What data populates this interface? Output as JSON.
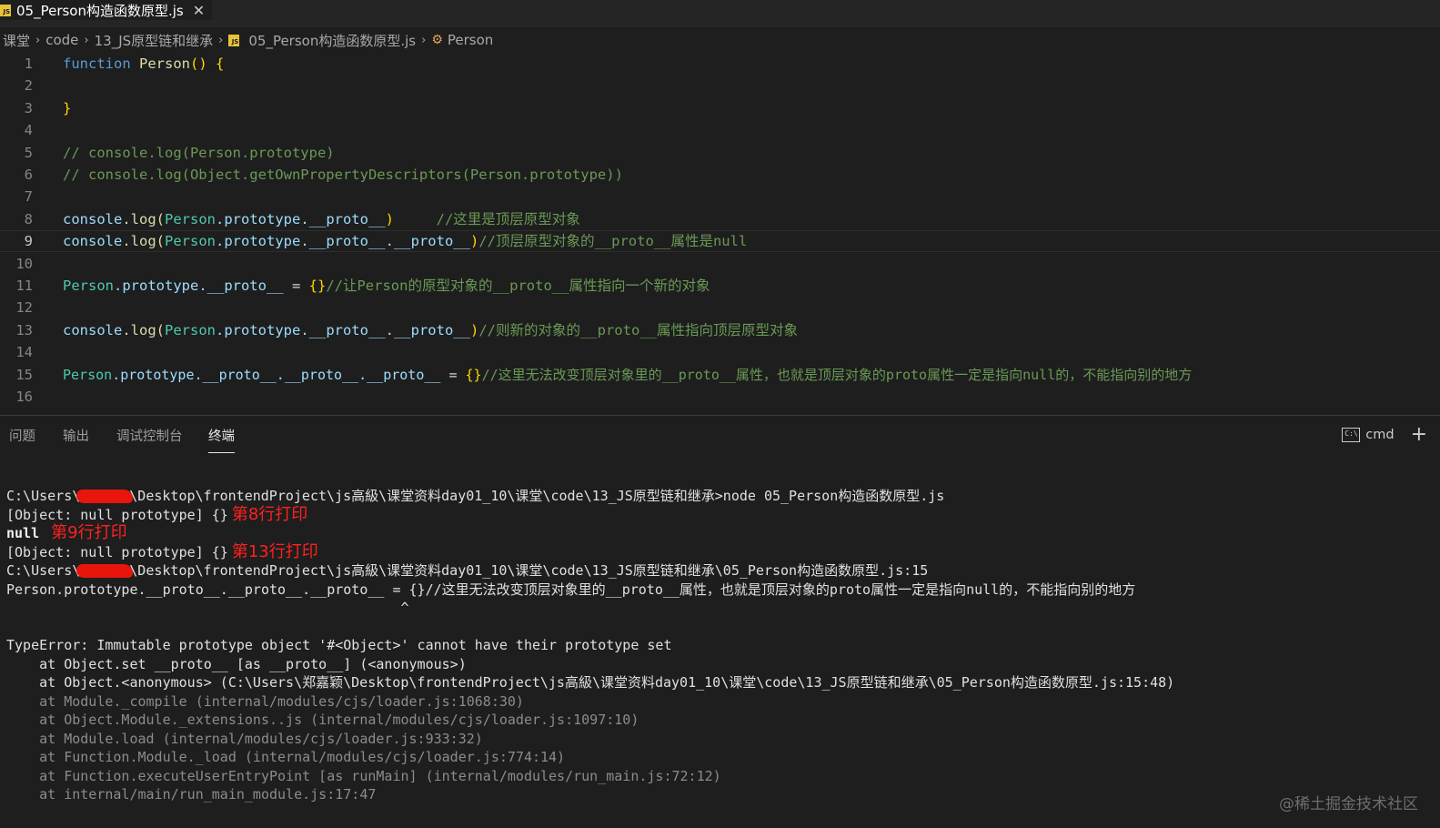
{
  "tab": {
    "icon": "js-file-icon",
    "title": "05_Person构造函数原型.js",
    "close": "✕"
  },
  "breadcrumb": {
    "items": [
      "课堂",
      "code",
      "13_JS原型链和继承",
      "05_Person构造函数原型.js",
      "Person"
    ],
    "sep": "›"
  },
  "editor": {
    "current_line": 9,
    "lines": [
      {
        "n": "1"
      },
      {
        "n": "2"
      },
      {
        "n": "3"
      },
      {
        "n": "4"
      },
      {
        "n": "5"
      },
      {
        "n": "6"
      },
      {
        "n": "7"
      },
      {
        "n": "8"
      },
      {
        "n": "9"
      },
      {
        "n": "10"
      },
      {
        "n": "11"
      },
      {
        "n": "12"
      },
      {
        "n": "13"
      },
      {
        "n": "14"
      },
      {
        "n": "15"
      },
      {
        "n": "16"
      }
    ],
    "code": {
      "l1_kw": "function",
      "l1_fn": "Person",
      "l1_paren": "()",
      "l1_brace": "{",
      "l3_brace": "}",
      "l5": "// console.log(Person.prototype)",
      "l6": "// console.log(Object.getOwnPropertyDescriptors(Person.prototype))",
      "l8_code_a": "console",
      "l8_code_b": ".log(",
      "l8_cls": "Person",
      "l8_rest": ".prototype.__proto__",
      "l8_close": ")",
      "l8_cm": "     //这里是顶层原型对象",
      "l9_code_a": "console",
      "l9_code_b": ".log(",
      "l9_cls": "Person",
      "l9_rest": ".prototype.__proto__.__proto__",
      "l9_close": ")",
      "l9_cm": "//顶层原型对象的__proto__属性是null",
      "l11_cls": "Person",
      "l11_rest": ".prototype.__proto__",
      "l11_eq": " = ",
      "l11_obj": "{}",
      "l11_cm": "//让Person的原型对象的__proto__属性指向一个新的对象",
      "l13_code_a": "console",
      "l13_code_b": ".log(",
      "l13_cls": "Person",
      "l13_rest": ".prototype.__proto__.__proto__",
      "l13_close": ")",
      "l13_cm": "//则新的对象的__proto__属性指向顶层原型对象",
      "l15_cls": "Person",
      "l15_rest": ".prototype.__proto__.__proto__.__proto__",
      "l15_eq": " = ",
      "l15_obj": "{}",
      "l15_cm": "//这里无法改变顶层对象里的__proto__属性，也就是顶层对象的proto属性一定是指向null的，不能指向别的地方"
    }
  },
  "panel": {
    "tabs": [
      "问题",
      "输出",
      "调试控制台",
      "终端"
    ],
    "active_tab": "终端",
    "terminal_shell": "cmd",
    "shell_icon": "terminal-cmd-icon",
    "add_icon": "+"
  },
  "terminal": {
    "l1_a": "C:\\Users\\",
    "l1_b": "\\Desktop\\frontendProject\\js高級\\课堂资料day01_10\\课堂\\code\\13_JS原型链和继承>node 05_Person构造函数原型.js",
    "l2": "[Object: null prototype] {}",
    "l2_ann": "第8行打印",
    "l3": "null",
    "l3_ann": "第9行打印",
    "l4": "[Object: null prototype] {}",
    "l4_ann": "第13行打印",
    "l5_a": "C:\\Users\\",
    "l5_b": "\\Desktop\\frontendProject\\js高級\\课堂资料day01_10\\课堂\\code\\13_JS原型链和继承\\05_Person构造函数原型.js:15",
    "l6": "Person.prototype.__proto__.__proto__.__proto__ = {}//这里无法改变顶层对象里的__proto__属性，也就是顶层对象的proto属性一定是指向null的，不能指向别的地方",
    "l7": "                                                ^",
    "l9": "TypeError: Immutable prototype object '#<Object>' cannot have their prototype set",
    "l10": "    at Object.set __proto__ [as __proto__] (<anonymous>)",
    "l11": "    at Object.<anonymous> (C:\\Users\\郑嘉颖\\Desktop\\frontendProject\\js高級\\课堂资料day01_10\\课堂\\code\\13_JS原型链和继承\\05_Person构造函数原型.js:15:48)",
    "l12": "    at Module._compile (internal/modules/cjs/loader.js:1068:30)",
    "l13": "    at Object.Module._extensions..js (internal/modules/cjs/loader.js:1097:10)",
    "l14": "    at Module.load (internal/modules/cjs/loader.js:933:32)",
    "l15": "    at Function.Module._load (internal/modules/cjs/loader.js:774:14)",
    "l16": "    at Function.executeUserEntryPoint [as runMain] (internal/modules/run_main.js:72:12)",
    "l17": "    at internal/main/run_main_module.js:17:47"
  },
  "watermark": "@稀土掘金技术社区"
}
